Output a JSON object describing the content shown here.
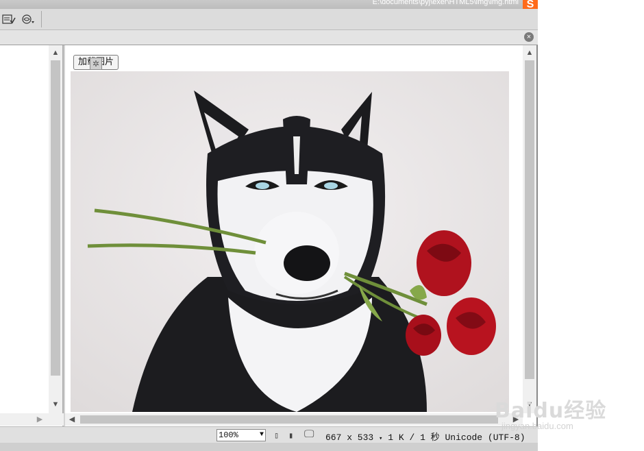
{
  "titlebar": {
    "path": "E:\\documents\\pyj\\exer\\HTML5\\img\\img.html",
    "brand_letter": "S"
  },
  "toolbar": {
    "icons": [
      "check-list-icon",
      "preview-icon"
    ]
  },
  "docbar": {
    "close_glyph": "×"
  },
  "design": {
    "button_label": "加载图片"
  },
  "statusbar": {
    "zoom": "100%",
    "dimensions": "667 x 533",
    "filesize": "1 K / 1 秒",
    "encoding": "Unicode (UTF-8)"
  },
  "watermark": {
    "logo": "Baidu经验",
    "url": "jingyan.baidu.com"
  },
  "colors": {
    "frame": "#d4d4d4",
    "brand": "#ff6a1a",
    "rose": "#b0121e",
    "stem": "#6f8f3a"
  }
}
